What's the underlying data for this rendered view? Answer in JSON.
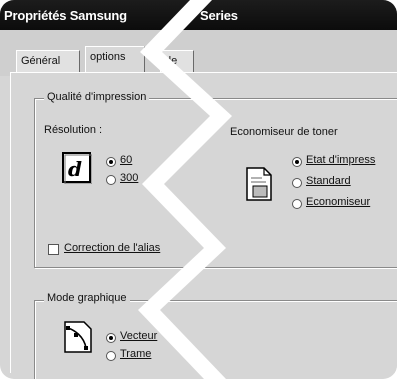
{
  "window": {
    "title_left": "Propriétés Samsung",
    "title_right": "Series"
  },
  "tabs": [
    {
      "label": "Général"
    },
    {
      "label": "options"
    },
    {
      "label": "de"
    }
  ],
  "print_quality": {
    "legend": "Qualité d'impression",
    "resolution_label": "Résolution :",
    "options": [
      {
        "label": "60",
        "checked": true
      },
      {
        "label": "300",
        "checked": false
      }
    ]
  },
  "toner_saver": {
    "label": "Economiseur de toner",
    "options": [
      {
        "label": "Etat d'impress",
        "checked": true
      },
      {
        "label": "Standard",
        "checked": false
      },
      {
        "label": "Economiseur",
        "checked": false
      }
    ]
  },
  "edge_correction": {
    "label": "Correction de l'alias",
    "checked": false
  },
  "graphics_mode": {
    "legend": "Mode graphique",
    "options": [
      {
        "label": "Vecteur",
        "checked": true
      },
      {
        "label": "Trame",
        "checked": false
      }
    ]
  },
  "icons": [
    "print-quality-letter-icon",
    "toner-saver-page-icon",
    "graphics-mode-curve-icon"
  ]
}
